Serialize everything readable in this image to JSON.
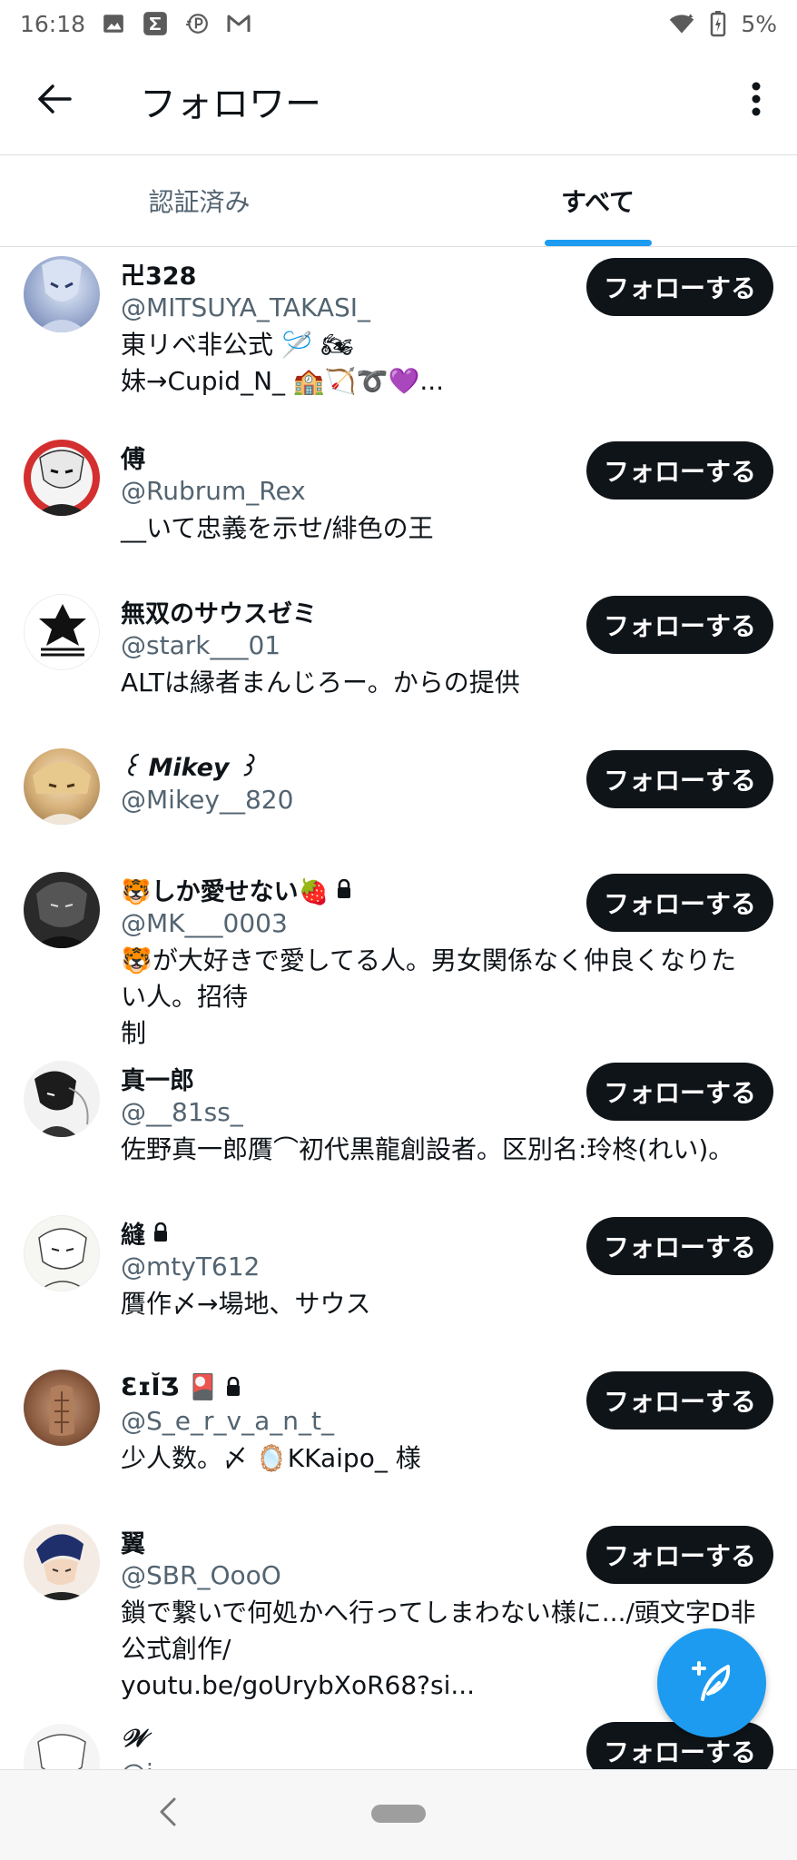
{
  "status_bar": {
    "time": "16:18",
    "battery": "5%",
    "icons": [
      "image-icon",
      "sigma-app-icon",
      "p-app-icon",
      "mail-icon",
      "wifi-icon",
      "battery-charging-icon"
    ]
  },
  "app_bar": {
    "title": "フォロワー",
    "back_icon": "arrow-left-icon",
    "more_icon": "more-vertical-icon"
  },
  "tabs": [
    {
      "label": "認証済み",
      "active": false
    },
    {
      "label": "すべて",
      "active": true
    }
  ],
  "follow_label": "フォローする",
  "followers": [
    {
      "name": "卍328",
      "handle": "@MITSUYA_TAKASI_",
      "bio": [
        "東リベ非公式 🪡 🏍",
        "妹→Cupid_N_ 🏫🏹➰💜..."
      ],
      "locked": false
    },
    {
      "name": "傅",
      "handle": "@Rubrum_Rex",
      "bio": [
        "__いて忠義を示せ/緋色の王"
      ],
      "locked": false
    },
    {
      "name": "無双のサウスゼミ",
      "handle": "@stark___01",
      "bio": [
        "ALTは縁者まんじろー。からの提供"
      ],
      "locked": false
    },
    {
      "name": "꒰ Mikey ꒱",
      "handle": "@Mikey__820",
      "bio": [],
      "locked": false
    },
    {
      "name": "🐯しか愛せない🍓",
      "handle": "@MK___0003",
      "bio": [
        "🐯が大好きで愛してる人。男女関係なく仲良くなりたい人。招待",
        "制"
      ],
      "locked": true
    },
    {
      "name": "真一郎",
      "handle": "@__81ss_",
      "bio": [
        "佐野真一郎贋⌒初代黒龍創設者。区別名:玲柊(れい)。"
      ],
      "locked": false
    },
    {
      "name": "縫",
      "handle": "@mtyT612",
      "bio": [
        "贋作〆→場地、サウス"
      ],
      "locked": true
    },
    {
      "name": "ƐɪĬƷ 🎴",
      "handle": "@S_e_r_v_a_n_t_",
      "bio": [
        "少人数。〆 🪞KKaipo_ 様"
      ],
      "locked": true
    },
    {
      "name": "翼",
      "handle": "@SBR_OooO",
      "bio": [
        "鎖で繋いで何処かへ行ってしまわない様に.../頭文字D非公式創作/",
        "youtu.be/goUrybXoR68?si..."
      ],
      "locked": false
    },
    {
      "name": "𝒲",
      "handle": "@i_______",
      "bio": [],
      "locked": false
    }
  ],
  "fab": {
    "icon": "compose-feather-icon"
  },
  "nav_bar": {
    "back_icon": "chevron-left-icon",
    "home_icon": "home-pill-icon"
  },
  "colors": {
    "accent": "#1d9bf0",
    "button": "#0f1419",
    "secondary_text": "#536471"
  }
}
